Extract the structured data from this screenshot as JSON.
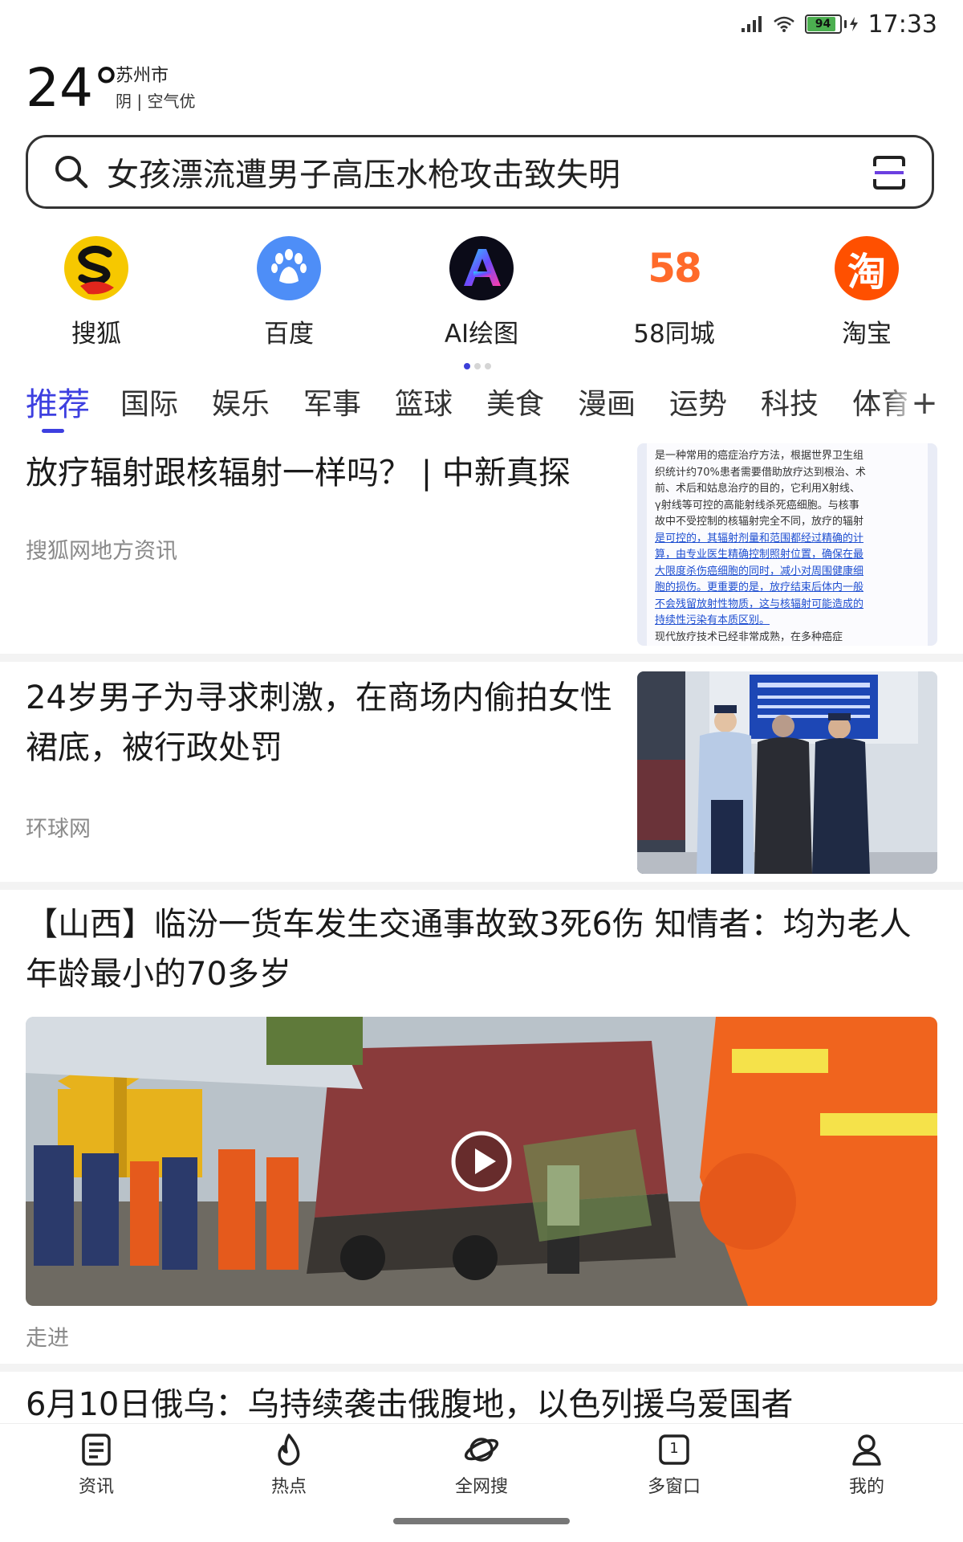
{
  "status_bar": {
    "time": "17:33",
    "battery_level": "94",
    "battery_percent": 94
  },
  "weather": {
    "temperature": "24°",
    "city": "苏州市",
    "condition": "阴 | 空气优"
  },
  "search": {
    "query": "女孩漂流遭男子高压水枪攻击致失明"
  },
  "quick_apps": [
    {
      "label": "搜狐",
      "icon": "sohu-logo-icon"
    },
    {
      "label": "百度",
      "icon": "baidu-paw-icon"
    },
    {
      "label": "AI绘图",
      "icon": "ai-drawing-icon"
    },
    {
      "label": "58同城",
      "icon": "58-logo-icon",
      "logo_text": "58"
    },
    {
      "label": "淘宝",
      "icon": "taobao-logo-icon",
      "logo_text": "淘"
    }
  ],
  "app_pager": {
    "pages": 3,
    "current": 1
  },
  "channel_tabs": {
    "items": [
      "推荐",
      "国际",
      "娱乐",
      "军事",
      "篮球",
      "美食",
      "漫画",
      "运势",
      "科技",
      "体育"
    ],
    "active": "推荐",
    "add_label": "+"
  },
  "colors": {
    "accent": "#3d3fe0",
    "sohu_yellow": "#f6c800",
    "baidu_blue": "#4e8ef7",
    "taobao_orange": "#ff5000"
  },
  "feed": [
    {
      "title": "放疗辐射跟核辐射一样吗？ | 中新真探",
      "source": "搜狐网地方资讯",
      "thumbnail": {
        "type": "document",
        "lines": [
          "是一种常用的癌症治疗方法，根据世界卫生组",
          "织统计约70%患者需要借助放疗达到根治、术",
          "前、术后和姑息治疗的目的，它利用X射线、",
          "γ射线等可控的高能射线杀死癌细胞。与核事",
          "故中不受控制的核辐射完全不同，放疗的辐射",
          "是可控的，其辐射剂量和范围都经过精确的计",
          "算，由专业医生精确控制照射位置，确保在最",
          "大限度杀伤癌细胞的同时，减小对周围健康细",
          "胞的损伤。更重要的是，放疗结束后体内一般",
          "不会残留放射性物质，这与核辐射可能造成的",
          "持续性污染有本质区别。",
          "现代放疗技术已经非常成熟，在多种癌症"
        ]
      }
    },
    {
      "title": "24岁男子为寻求刺激，在商场内偷拍女性裙底，被行政处罚",
      "source": "环球网"
    },
    {
      "title": "【山西】临汾一货车发生交通事故致3死6伤 知情者：均为老人 年龄最小的70多岁",
      "source": "走进",
      "media": "video"
    },
    {
      "title": "6月10日俄乌：乌持续袭击俄腹地，以色列援乌爱国者"
    }
  ],
  "bottom_nav": [
    {
      "label": "资讯",
      "icon": "news-icon"
    },
    {
      "label": "热点",
      "icon": "flame-icon"
    },
    {
      "label": "全网搜",
      "icon": "planet-icon"
    },
    {
      "label": "多窗口",
      "icon": "windows-icon",
      "count": "1"
    },
    {
      "label": "我的",
      "icon": "user-icon"
    }
  ]
}
